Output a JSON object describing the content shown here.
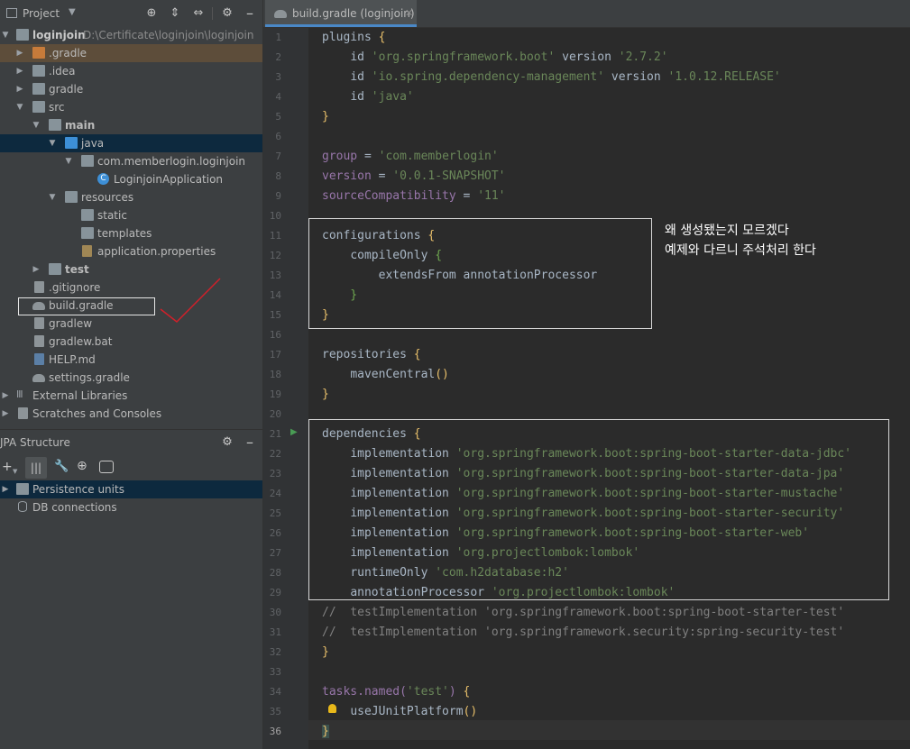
{
  "project_panel": {
    "title": "Project",
    "tree": [
      {
        "label": "loginjoin",
        "path": "D:\\Certificate\\loginjoin\\loginjoin"
      },
      {
        "label": ".gradle"
      },
      {
        "label": ".idea"
      },
      {
        "label": "gradle"
      },
      {
        "label": "src"
      },
      {
        "label": "main"
      },
      {
        "label": "java"
      },
      {
        "label": "com.memberlogin.loginjoin"
      },
      {
        "label": "LoginjoinApplication"
      },
      {
        "label": "resources"
      },
      {
        "label": "static"
      },
      {
        "label": "templates"
      },
      {
        "label": "application.properties"
      },
      {
        "label": "test"
      },
      {
        "label": ".gitignore"
      },
      {
        "label": "build.gradle"
      },
      {
        "label": "gradlew"
      },
      {
        "label": "gradlew.bat"
      },
      {
        "label": "HELP.md"
      },
      {
        "label": "settings.gradle"
      },
      {
        "label": "External Libraries"
      },
      {
        "label": "Scratches and Consoles"
      }
    ]
  },
  "jpa_panel": {
    "title": "JPA Structure",
    "items": [
      {
        "label": "Persistence units"
      },
      {
        "label": "DB connections"
      }
    ]
  },
  "editor": {
    "tab_label": "build.gradle (loginjoin)",
    "current_line": 36,
    "line_numbers": [
      "1",
      "2",
      "3",
      "4",
      "5",
      "6",
      "7",
      "8",
      "9",
      "10",
      "11",
      "12",
      "13",
      "14",
      "15",
      "16",
      "17",
      "18",
      "19",
      "20",
      "21",
      "22",
      "23",
      "24",
      "25",
      "26",
      "27",
      "28",
      "29",
      "30",
      "31",
      "32",
      "33",
      "34",
      "35",
      "36"
    ],
    "annotation": {
      "line1": "왜 생성됐는지 모르겠다",
      "line2": "예제와 다르니 주석처리 한다"
    }
  },
  "code": {
    "l1": "plugins",
    "l2_id": "id",
    "l2_str": "'org.springframework.boot'",
    "l2_ver": "version",
    "l2_verstr": "'2.7.2'",
    "l3_str": "'io.spring.dependency-management'",
    "l3_verstr": "'1.0.12.RELEASE'",
    "l4_str": "'java'",
    "l7_prop": "group",
    "l7_str": "'com.memberlogin'",
    "l8_prop": "version",
    "l8_str": "'0.0.1-SNAPSHOT'",
    "l9_prop": "sourceCompatibility",
    "l9_str": "'11'",
    "l11": "configurations",
    "l12": "compileOnly",
    "l13": "extendsFrom annotationProcessor",
    "l17": "repositories",
    "l18": "mavenCentral",
    "l21": "dependencies",
    "impl": "implementation",
    "l22_str": "'org.springframework.boot:spring-boot-starter-data-jdbc'",
    "l23_str": "'org.springframework.boot:spring-boot-starter-data-jpa'",
    "l24_str": "'org.springframework.boot:spring-boot-starter-mustache'",
    "l25_str": "'org.springframework.boot:spring-boot-starter-security'",
    "l26_str": "'org.springframework.boot:spring-boot-starter-web'",
    "l27_str": "'org.projectlombok:lombok'",
    "l28_kw": "runtimeOnly",
    "l28_str": "'com.h2database:h2'",
    "l29_kw": "annotationProcessor",
    "l29_str": "'org.projectlombok:lombok'",
    "l30": "//  testImplementation 'org.springframework.boot:spring-boot-starter-test'",
    "l31": "//  testImplementation 'org.springframework.security:spring-security-test'",
    "l34_a": "tasks.named(",
    "l34_str": "'test'",
    "l34_b": ")",
    "l35": "useJUnitPlatform"
  }
}
